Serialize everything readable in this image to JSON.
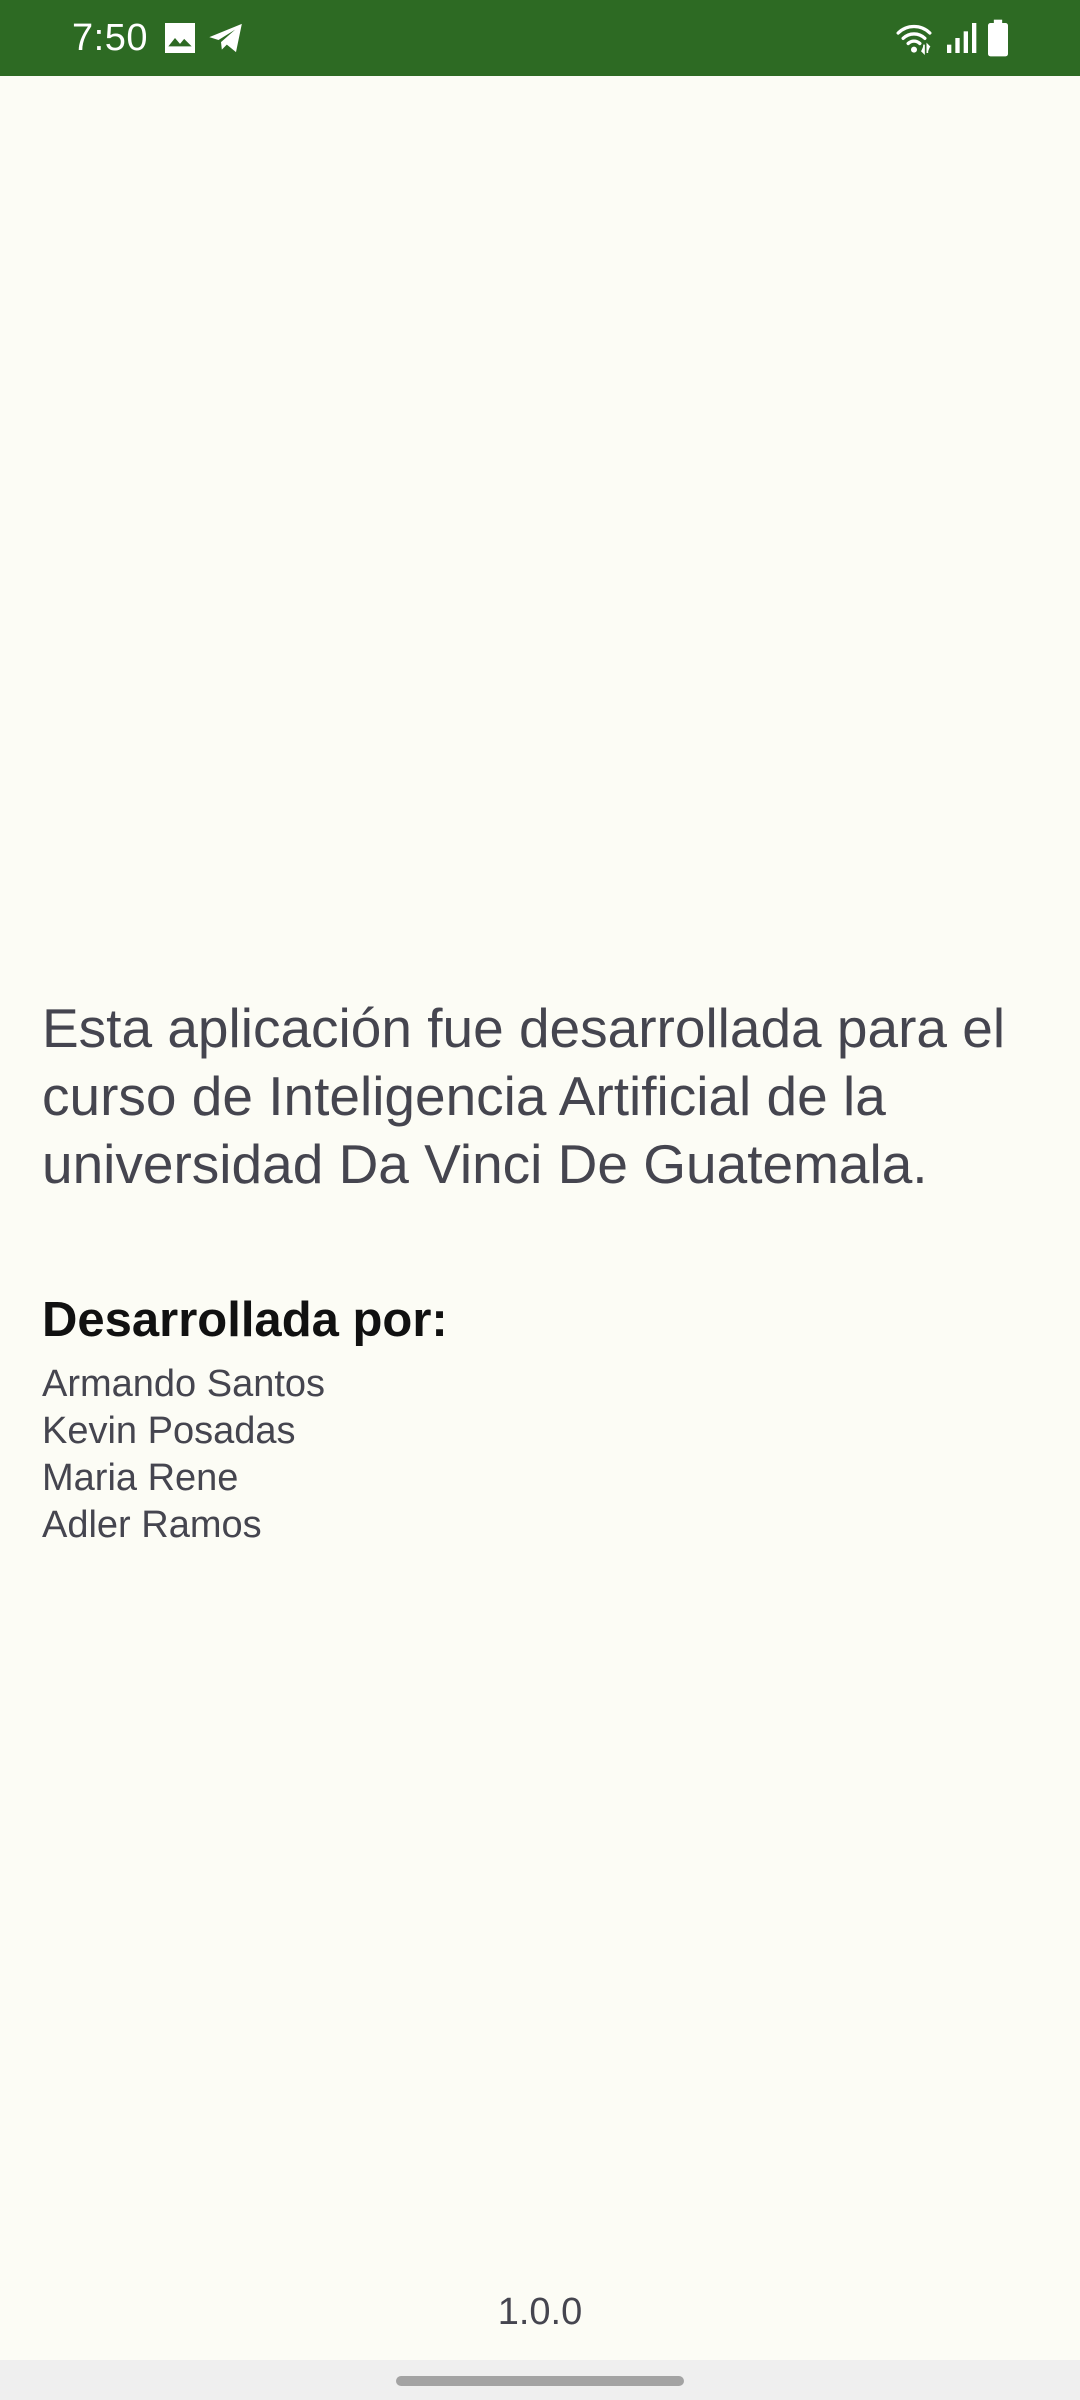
{
  "status_bar": {
    "time": "7:50",
    "background_color": "#2D6A23",
    "icons": [
      "image-icon",
      "telegram-icon",
      "wifi-icon",
      "signal-icon",
      "battery-icon"
    ]
  },
  "about": {
    "paragraph": "Esta aplicación fue desarrollada para el curso de Inteligencia Artificial de la universidad Da Vinci De Guatemala."
  },
  "credits": {
    "heading": "Desarrollada por:",
    "developers": [
      "Armando Santos",
      "Kevin Posadas",
      "Maria Rene",
      "Adler Ramos"
    ]
  },
  "footer": {
    "version": "1.0.0"
  },
  "colors": {
    "background": "#FCFCF5",
    "body_text": "#45454F",
    "heading_text": "#111111",
    "nav_bar": "#EFEFEF"
  }
}
